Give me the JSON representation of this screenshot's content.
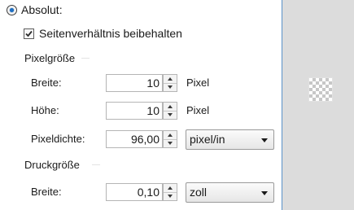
{
  "mode": {
    "label": "Absolut:",
    "selected": true
  },
  "keep_aspect": {
    "label": "Seitenverhältnis beibehalten",
    "checked": true
  },
  "pixel_size": {
    "title": "Pixelgröße",
    "width": {
      "label": "Breite:",
      "value": "10",
      "unit": "Pixel"
    },
    "height": {
      "label": "Höhe:",
      "value": "10",
      "unit": "Pixel"
    },
    "density": {
      "label": "Pixeldichte:",
      "value": "96,00",
      "unit_selected": "pixel/in"
    }
  },
  "print_size": {
    "title": "Druckgröße",
    "width": {
      "label": "Breite:",
      "value": "0,10",
      "unit_selected": "zoll"
    }
  },
  "colors": {
    "accent": "#1d6fc4",
    "panel_border": "#5a92c9",
    "preview_bg": "#dcdcdc"
  },
  "preview": {
    "icon": "transparency-checker-icon"
  }
}
